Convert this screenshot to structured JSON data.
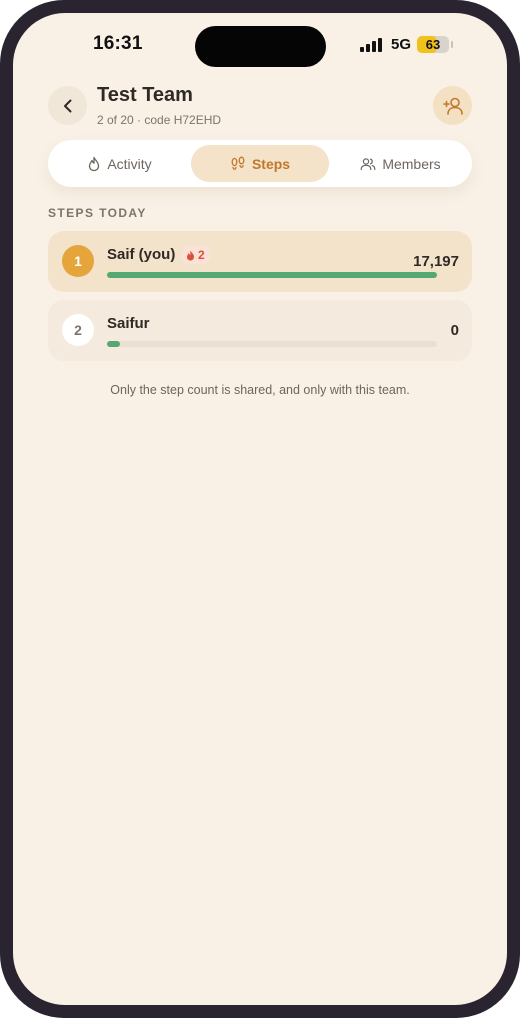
{
  "status_bar": {
    "time": "16:31",
    "network": "5G",
    "battery_percent": "63",
    "battery_level": 0.63
  },
  "header": {
    "back_icon": "chevron-left-icon",
    "title": "Test Team",
    "subtitle": "2 of 20 · code H72EHD",
    "add_member_icon": "person-add-icon"
  },
  "tabs": [
    {
      "label": "Activity",
      "icon": "flame-outline-icon",
      "active": false
    },
    {
      "label": "Steps",
      "icon": "footprints-icon",
      "active": true
    },
    {
      "label": "Members",
      "icon": "people-icon",
      "active": false
    }
  ],
  "section": {
    "heading": "STEPS TODAY"
  },
  "leaderboard": [
    {
      "rank": "1",
      "name": "Saif (you)",
      "streak": "2",
      "steps": "17,197",
      "progress": 1.0
    },
    {
      "rank": "2",
      "name": "Saifur",
      "steps": "0",
      "progress": 0.0
    }
  ],
  "footnote": "Only the step count is shared, and only with this team.",
  "colors": {
    "background": "#f9f1e6",
    "accent": "#c0792b",
    "progress": "#55a773",
    "gold": "#e5a53a",
    "streak": "#d9533b"
  }
}
